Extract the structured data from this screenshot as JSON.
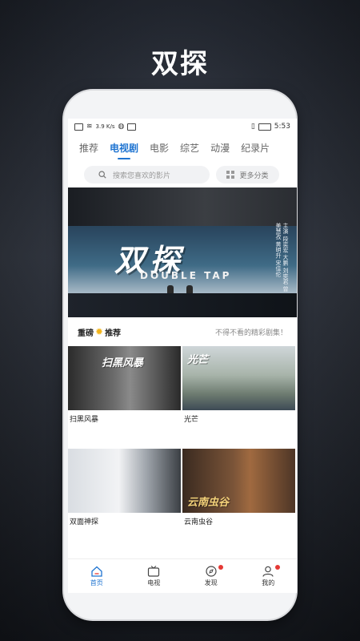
{
  "hero_title": "双探",
  "status": {
    "speed": "3.9 K/s",
    "time": "5:53"
  },
  "tabs": [
    {
      "label": "推荐",
      "active": false
    },
    {
      "label": "电视剧",
      "active": true
    },
    {
      "label": "电影",
      "active": false
    },
    {
      "label": "综艺",
      "active": false
    },
    {
      "label": "动漫",
      "active": false
    },
    {
      "label": "纪录片",
      "active": false
    }
  ],
  "search": {
    "placeholder": "搜索您喜欢的影片",
    "more_label": "更多分类"
  },
  "banner": {
    "title_cn": "双探",
    "title_en": "DOUBLE TAP",
    "credits": "主演 段奕宏 大鹏 刘奕君 曾美慧孜 黄明升 宋佳伦"
  },
  "section": {
    "title_left": "重磅",
    "title_right": "推荐",
    "subtitle": "不得不看的精彩剧集！"
  },
  "shows": [
    {
      "title": "扫黑风暴",
      "thumb_text": "扫黑风暴"
    },
    {
      "title": "光芒",
      "thumb_text": "光芒"
    },
    {
      "title": "双面神探",
      "thumb_text": ""
    },
    {
      "title": "云南虫谷",
      "thumb_text": "云南虫谷"
    }
  ],
  "nav": [
    {
      "label": "首页",
      "active": true,
      "badge": false
    },
    {
      "label": "电视",
      "active": false,
      "badge": false
    },
    {
      "label": "发现",
      "active": false,
      "badge": true
    },
    {
      "label": "我的",
      "active": false,
      "badge": true
    }
  ],
  "colors": {
    "accent": "#1f74d1",
    "badge": "#e53935",
    "star": "#f3b51b"
  }
}
